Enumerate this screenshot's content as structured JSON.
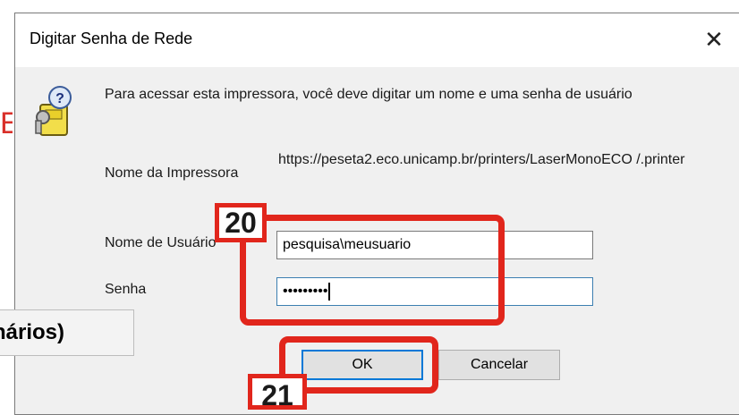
{
  "background": {
    "red_fragment": "E",
    "bold_fragment": "nários)"
  },
  "dialog": {
    "title": "Digitar Senha de Rede",
    "close_glyph": "✕",
    "message": "Para acessar esta impressora, você deve digitar um nome e uma senha de usuário",
    "printer_label": "Nome da Impressora",
    "printer_url": "https://peseta2.eco.unicamp.br/printers/LaserMonoECO /.printer",
    "username_label": "Nome de Usuário",
    "username_value": "pesquisa\\meusuario",
    "password_label": "Senha",
    "password_value": "•••••••••",
    "ok_label": "OK",
    "cancel_label": "Cancelar",
    "icon": "lock-help-icon"
  },
  "annotations": {
    "step20": "20",
    "step21": "21",
    "color": "#e1261c"
  }
}
